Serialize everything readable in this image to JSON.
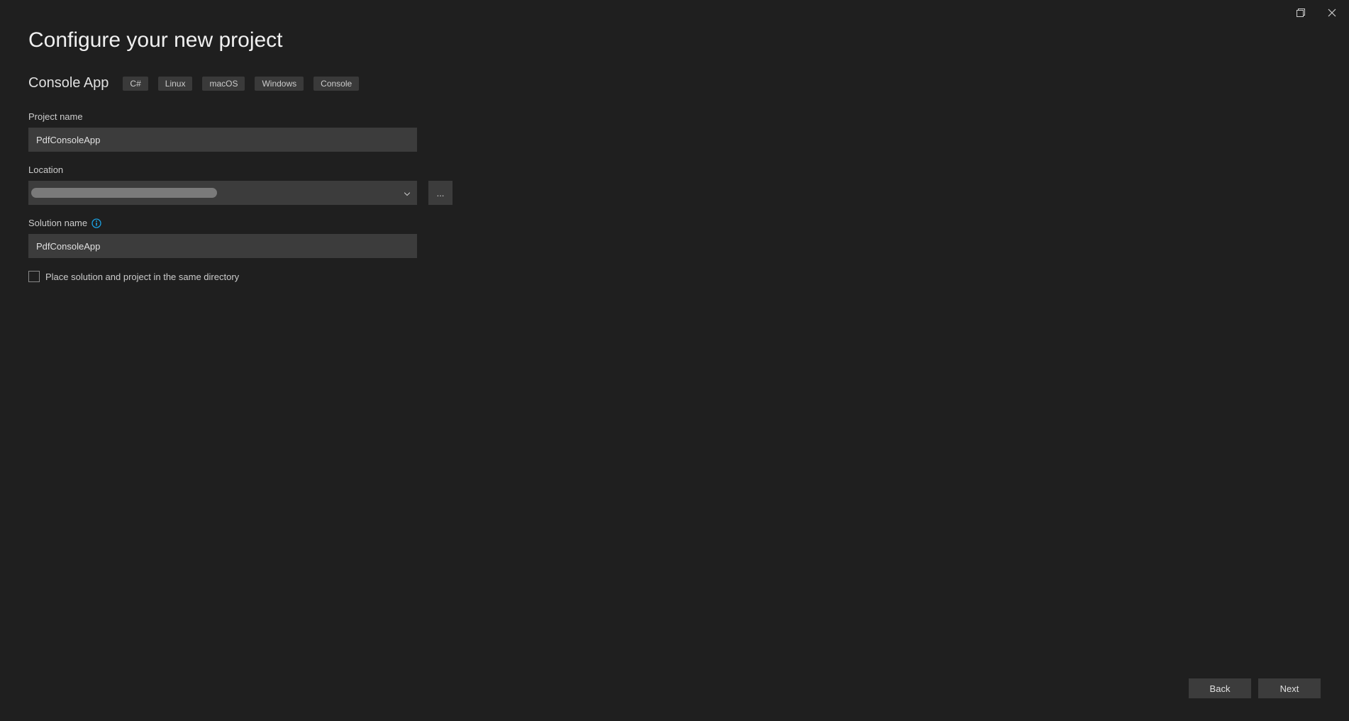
{
  "window": {
    "title": "Configure your new project"
  },
  "template": {
    "name": "Console App",
    "tags": [
      "C#",
      "Linux",
      "macOS",
      "Windows",
      "Console"
    ]
  },
  "fields": {
    "project_name": {
      "label": "Project name",
      "value": "PdfConsoleApp"
    },
    "location": {
      "label": "Location",
      "value": "",
      "browse_label": "..."
    },
    "solution_name": {
      "label": "Solution name",
      "value": "PdfConsoleApp",
      "info_tooltip": "i"
    },
    "same_directory": {
      "label": "Place solution and project in the same directory",
      "checked": false
    }
  },
  "footer": {
    "back": "Back",
    "next": "Next"
  }
}
